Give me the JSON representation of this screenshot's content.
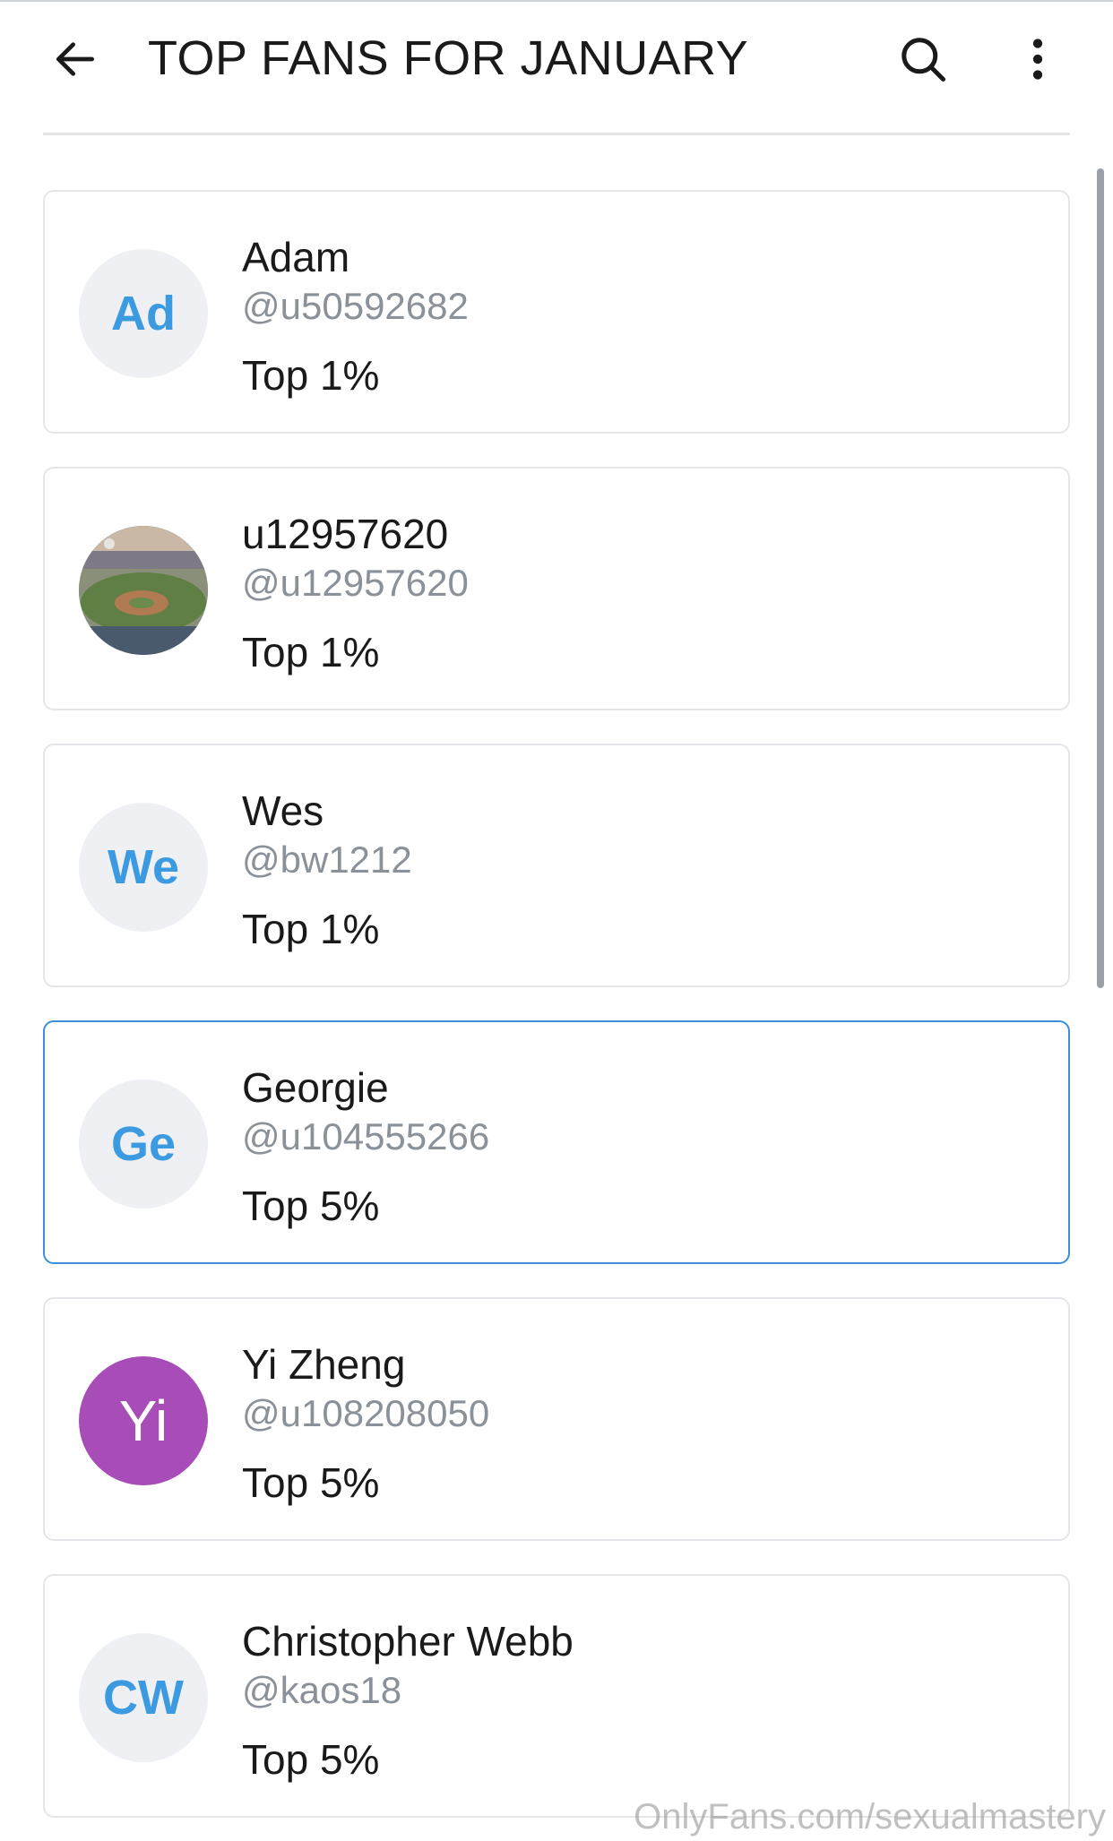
{
  "header": {
    "title": "TOP FANS FOR JANUARY",
    "back_icon": "arrow-left-icon",
    "search_icon": "search-icon",
    "more_icon": "more-vertical-icon"
  },
  "fans": [
    {
      "name": "Adam",
      "handle": "@u50592682",
      "rank": "Top 1%",
      "initials": "Ad",
      "avatar_type": "initials",
      "selected": false
    },
    {
      "name": "u12957620",
      "handle": "@u12957620",
      "rank": "Top 1%",
      "initials": "",
      "avatar_type": "photo",
      "selected": false
    },
    {
      "name": "Wes",
      "handle": "@bw1212",
      "rank": "Top 1%",
      "initials": "We",
      "avatar_type": "initials",
      "selected": false
    },
    {
      "name": "Georgie",
      "handle": "@u104555266",
      "rank": "Top 5%",
      "initials": "Ge",
      "avatar_type": "initials",
      "selected": true
    },
    {
      "name": "Yi Zheng",
      "handle": "@u108208050",
      "rank": "Top 5%",
      "initials": "Yi",
      "avatar_type": "initials-purple",
      "selected": false
    },
    {
      "name": "Christopher Webb",
      "handle": "@kaos18",
      "rank": "Top 5%",
      "initials": "CW",
      "avatar_type": "initials",
      "selected": false
    }
  ],
  "watermark": "OnlyFans.com/sexualmastery",
  "colors": {
    "accent": "#3b9ae0",
    "selected_border": "#3b8ed8",
    "purple_avatar": "#a84cb8",
    "handle_gray": "#8a9199"
  }
}
